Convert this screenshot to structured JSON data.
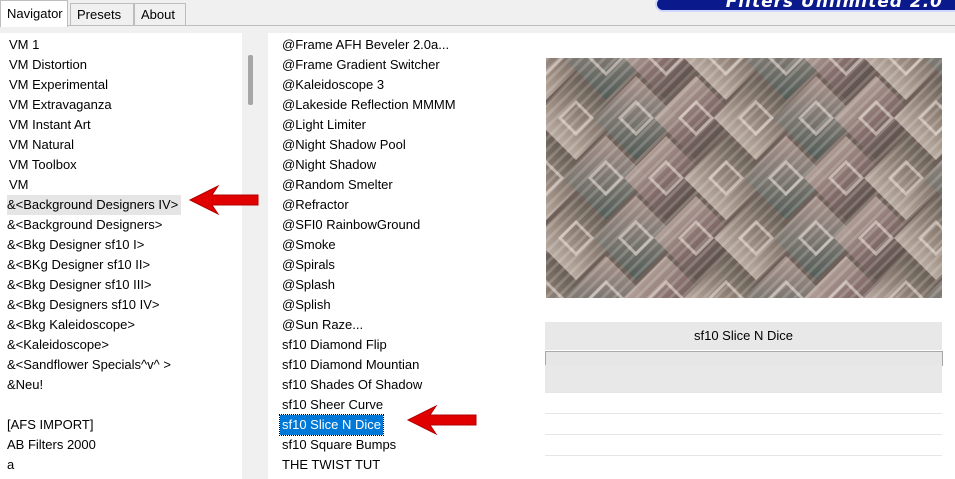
{
  "tabs": {
    "navigator": "Navigator",
    "presets": "Presets",
    "about": "About"
  },
  "banner": {
    "title": "Filters Unlimited 2.0"
  },
  "categories": [
    "VM 1",
    "VM Distortion",
    "VM Experimental",
    "VM Extravaganza",
    "VM Instant Art",
    "VM Natural",
    "VM Toolbox",
    "VM",
    "&<Background Designers IV>",
    "&<Background Designers>",
    "&<Bkg Designer sf10 I>",
    "&<BKg Designer sf10 II>",
    "&<Bkg Designer sf10 III>",
    "&<Bkg Designers sf10 IV>",
    "&<Bkg Kaleidoscope>",
    "&<Kaleidoscope>",
    "&<Sandflower Specials^v^ >",
    "&Neu!",
    "",
    "[AFS IMPORT]",
    "AB Filters 2000",
    "a"
  ],
  "filters": [
    "@Frame AFH Beveler 2.0a...",
    "@Frame Gradient Switcher",
    "@Kaleidoscope 3",
    "@Lakeside Reflection MMMM",
    "@Light Limiter",
    "@Night Shadow Pool",
    "@Night Shadow",
    "@Random Smelter",
    "@Refractor",
    "@SFI0 RainbowGround",
    "@Smoke",
    "@Spirals",
    "@Splash",
    "@Splish",
    "@Sun Raze...",
    "sf10 Diamond Flip",
    "sf10 Diamond Mountian",
    "sf10 Shades Of Shadow",
    "sf10 Sheer Curve",
    "sf10 Slice N Dice",
    "sf10 Square Bumps",
    "THE TWIST TUT"
  ],
  "selected_filter_name": "sf10 Slice N Dice",
  "colors": {
    "selection": "#0078d7",
    "annotation_arrow": "#e00000",
    "banner": "#0a1a8c"
  }
}
